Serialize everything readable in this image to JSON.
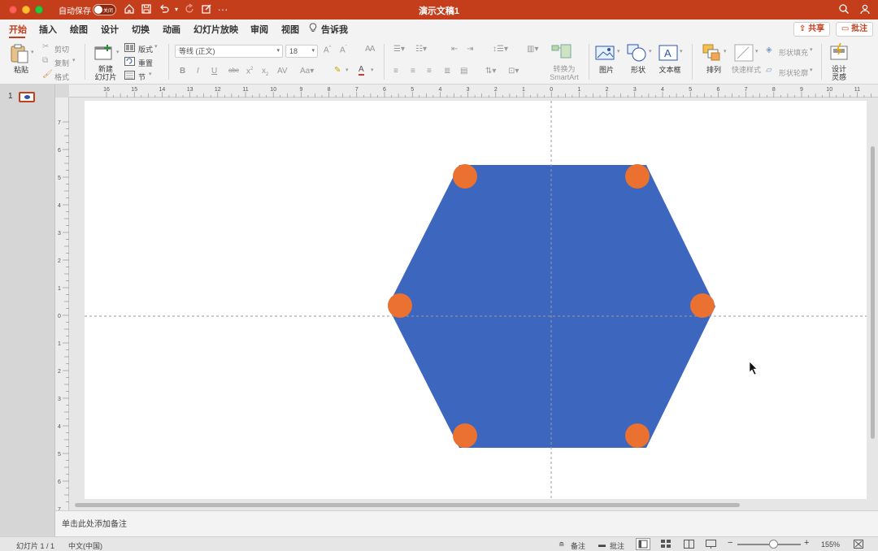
{
  "titlebar": {
    "autosave_label": "自动保存",
    "autosave_state": "关闭",
    "doc_title": "演示文稿1"
  },
  "tabs": [
    {
      "label": "开始",
      "active": true
    },
    {
      "label": "插入"
    },
    {
      "label": "绘图"
    },
    {
      "label": "设计"
    },
    {
      "label": "切换"
    },
    {
      "label": "动画"
    },
    {
      "label": "幻灯片放映"
    },
    {
      "label": "审阅"
    },
    {
      "label": "视图"
    },
    {
      "label": "告诉我"
    }
  ],
  "share": {
    "label": "共享"
  },
  "comments": {
    "label": "批注"
  },
  "ribbon": {
    "paste": "粘贴",
    "cut": "剪切",
    "copy": "复制",
    "format": "格式",
    "new_slide_line1": "新建",
    "new_slide_line2": "幻灯片",
    "layout": "版式",
    "reset": "重置",
    "section": "节",
    "font_name": "等线 (正文)",
    "font_size": "18",
    "convert_line1": "转换为",
    "convert_line2": "SmartArt",
    "picture": "图片",
    "shape": "形状",
    "textbox": "文本框",
    "arrange": "排列",
    "quick_styles": "快速样式",
    "shape_fill": "形状填充",
    "shape_outline": "形状轮廓",
    "designer_line1": "设计",
    "designer_line2": "灵感"
  },
  "thumbnails": {
    "slide_number": "1"
  },
  "hruler_labels": [
    "16",
    "15",
    "14",
    "13",
    "12",
    "11",
    "10",
    "9",
    "8",
    "7",
    "6",
    "5",
    "4",
    "3",
    "2",
    "1",
    "0",
    "1",
    "2",
    "3",
    "4",
    "5",
    "6",
    "7",
    "8",
    "9",
    "10",
    "11",
    "12",
    "13",
    "14",
    "15",
    "16"
  ],
  "vruler_labels": [
    "7",
    "6",
    "5",
    "4",
    "3",
    "2",
    "1",
    "0",
    "1",
    "2",
    "3",
    "4",
    "5",
    "6",
    "7"
  ],
  "notes": {
    "placeholder": "单击此处添加备注"
  },
  "statusbar": {
    "slide_info": "幻灯片 1 / 1",
    "language": "中文(中国)",
    "notes": "备注",
    "comments": "批注",
    "zoom": "155%"
  },
  "colors": {
    "accent": "#c43e1c",
    "hexagon": "#3d67be",
    "handle": "#eb7130"
  }
}
